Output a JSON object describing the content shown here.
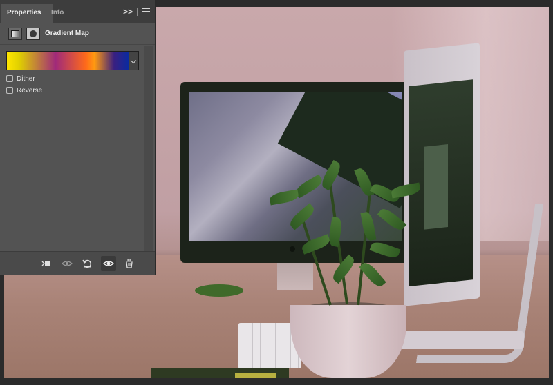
{
  "panel": {
    "tabs": [
      {
        "label": "Properties",
        "active": true
      },
      {
        "label": "Info",
        "active": false
      }
    ],
    "collapse_label": ">>",
    "title": "Gradient Map",
    "gradient": {
      "colors": [
        "#ffe600",
        "#a02a7a",
        "#ff6a1a",
        "#0a2aa0"
      ]
    },
    "options": [
      {
        "label": "Dither",
        "checked": false
      },
      {
        "label": "Reverse",
        "checked": false
      }
    ],
    "footer_icons": [
      "clip-to-layer-icon",
      "view-previous-state-icon",
      "reset-icon",
      "visibility-eye-icon",
      "trash-icon"
    ]
  },
  "colors": {
    "panel_bg": "#535353",
    "tabbar_bg": "#3d3d3d",
    "canvas_tint": "#c9a8ab"
  }
}
